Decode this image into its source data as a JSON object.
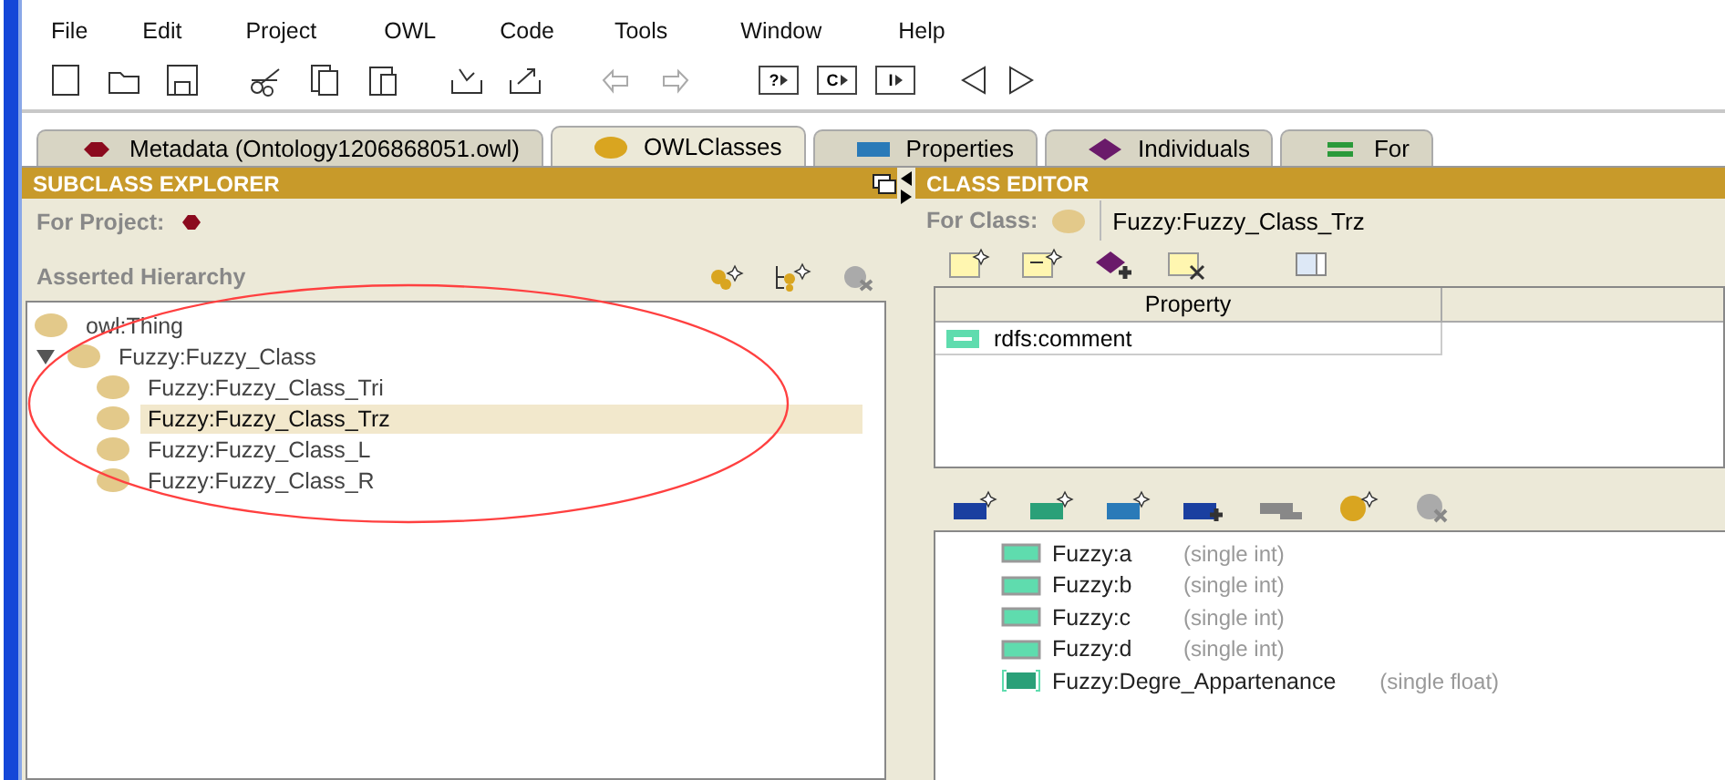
{
  "menu": [
    "File",
    "Edit",
    "Project",
    "OWL",
    "Code",
    "Tools",
    "Window",
    "Help"
  ],
  "toolbar_letter_buttons": [
    "?",
    "C",
    "I"
  ],
  "tabs": [
    {
      "label": "Metadata (Ontology1206868051.owl)",
      "selected": false,
      "kind": "hexagon",
      "color": "#8b0a1e"
    },
    {
      "label": "OWLClasses",
      "selected": true,
      "kind": "circle",
      "color": "#d9a520"
    },
    {
      "label": "Properties",
      "selected": false,
      "kind": "rect",
      "color": "#2a7ab8"
    },
    {
      "label": "Individuals",
      "selected": false,
      "kind": "diamond",
      "color": "#6a1a6a"
    },
    {
      "label": "For",
      "selected": false,
      "kind": "bars",
      "color": "#2a9a3a"
    }
  ],
  "subclass_explorer": {
    "title": "SUBCLASS EXPLORER",
    "project_label": "For Project:",
    "hierarchy_label": "Asserted Hierarchy",
    "tree": [
      {
        "label": "owl:Thing",
        "selected": false
      },
      {
        "label": "Fuzzy:Fuzzy_Class",
        "selected": false,
        "expanded": true,
        "children": [
          {
            "label": "Fuzzy:Fuzzy_Class_Tri",
            "selected": false
          },
          {
            "label": "Fuzzy:Fuzzy_Class_Trz",
            "selected": true
          },
          {
            "label": "Fuzzy:Fuzzy_Class_L",
            "selected": false
          },
          {
            "label": "Fuzzy:Fuzzy_Class_R",
            "selected": false
          }
        ]
      }
    ],
    "highlight": {
      "kind": "ellipse"
    }
  },
  "class_editor": {
    "title": "CLASS EDITOR",
    "class_label": "For Class:",
    "class_value": "Fuzzy:Fuzzy_Class_Trz",
    "table": {
      "columns": [
        "Property"
      ],
      "rows": [
        {
          "property": "rdfs:comment"
        }
      ]
    },
    "properties": [
      {
        "name": "Fuzzy:a",
        "type": "(single int)",
        "kind": "plain"
      },
      {
        "name": "Fuzzy:b",
        "type": "(single int)",
        "kind": "plain"
      },
      {
        "name": "Fuzzy:c",
        "type": "(single int)",
        "kind": "plain"
      },
      {
        "name": "Fuzzy:d",
        "type": "(single int)",
        "kind": "plain"
      },
      {
        "name": "Fuzzy:Degre_Appartenance",
        "type": "(single float)",
        "kind": "bracketed"
      }
    ]
  }
}
